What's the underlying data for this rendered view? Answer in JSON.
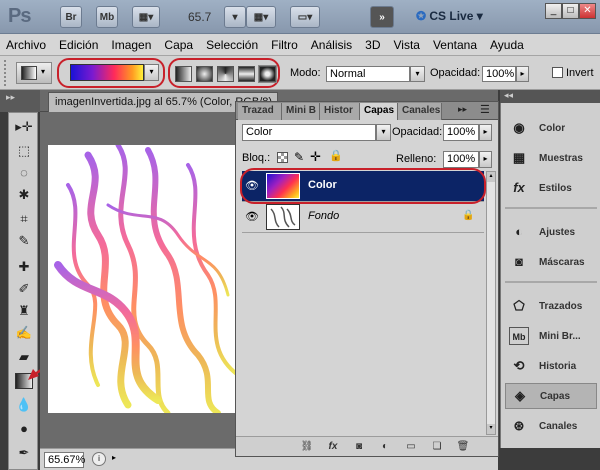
{
  "app": {
    "logo": "Ps",
    "bridge_label": "Br",
    "minibridge_label": "Mb",
    "zoom": "65.7",
    "cs_live": "CS Live",
    "window_buttons": [
      "_",
      "□",
      "✕"
    ]
  },
  "menu": [
    "Archivo",
    "Edición",
    "Imagen",
    "Capa",
    "Selección",
    "Filtro",
    "Análisis",
    "3D",
    "Vista",
    "Ventana",
    "Ayuda"
  ],
  "options": {
    "mode_label": "Modo:",
    "mode_value": "Normal",
    "opacity_label": "Opacidad:",
    "opacity_value": "100%",
    "invert_label": "Invert",
    "gradient_types": [
      "linear-gradient-icon",
      "radial-gradient-icon",
      "angle-gradient-icon",
      "reflected-gradient-icon",
      "diamond-gradient-icon"
    ]
  },
  "document": {
    "tab_title": "imagenInvertida.jpg al 65.7% (Color, RGB/8)",
    "status_zoom": "65.67%"
  },
  "layers_panel": {
    "tabs": [
      "Trazad",
      "Mini B",
      "Histor",
      "Capas",
      "Canales"
    ],
    "active_tab": "Capas",
    "blend_mode": "Color",
    "opacity_label": "Opacidad:",
    "opacity_value": "100%",
    "lock_label": "Bloq.:",
    "fill_label": "Relleno:",
    "fill_value": "100%",
    "layers": [
      {
        "name": "Color",
        "selected": true
      },
      {
        "name": "Fondo",
        "selected": false
      }
    ]
  },
  "dock": {
    "group1": [
      "Color",
      "Muestras",
      "Estilos"
    ],
    "group2": [
      "Ajustes",
      "Máscaras"
    ],
    "group3": [
      "Trazados",
      "Mini Br...",
      "Historia",
      "Capas",
      "Canales"
    ],
    "active": "Capas"
  },
  "colors": {
    "selected_layer": "#0c2466",
    "annotation_red": "#c8202a"
  }
}
